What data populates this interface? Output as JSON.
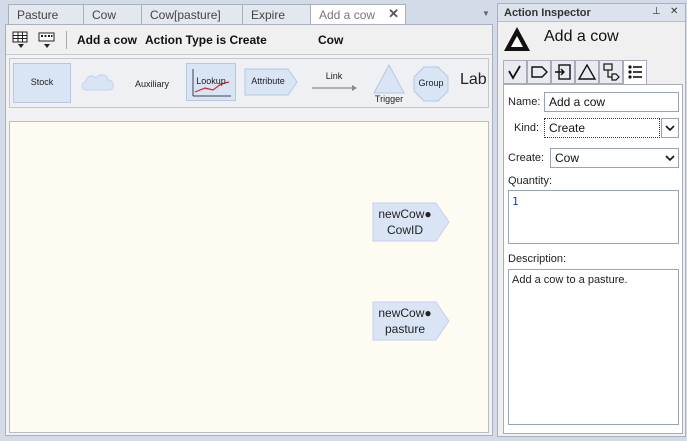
{
  "tabs": [
    {
      "label": "Pasture",
      "active": false
    },
    {
      "label": "Cow",
      "active": false
    },
    {
      "label": "Cow[pasture]",
      "active": false
    },
    {
      "label": "Expire",
      "active": false
    },
    {
      "label": "Add a cow",
      "active": true
    }
  ],
  "action_bar": {
    "title": "Add a cow",
    "type_text": "Action Type is Create",
    "agent": "Cow"
  },
  "palette": {
    "stock": "Stock",
    "auxiliary": "Auxiliary",
    "lookup": "Lookup",
    "attribute": "Attribute",
    "link": "Link",
    "trigger": "Trigger",
    "group": "Group",
    "label": "Lab"
  },
  "canvas": {
    "nodes": [
      {
        "line1": "newCow●",
        "line2": "CowID"
      },
      {
        "line1": "newCow●",
        "line2": "pasture"
      }
    ]
  },
  "inspector": {
    "title": "Action Inspector",
    "heading": "Add a cow",
    "name_label": "Name:",
    "name_value": "Add a cow",
    "kind_label": "Kind:",
    "kind_value": "Create",
    "create_label": "Create:",
    "create_value": "Cow",
    "quantity_label": "Quantity:",
    "quantity_value": "1",
    "description_label": "Description:",
    "description_value": "Add a cow to a pasture."
  },
  "colors": {
    "accent_shape": "#d9e4f5",
    "canvas_bg": "#fdfbf2",
    "quantity_text": "#1a3fb0"
  }
}
